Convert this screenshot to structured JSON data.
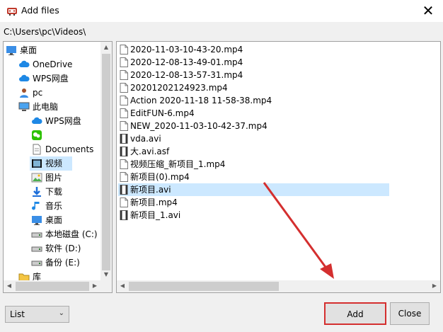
{
  "window": {
    "title": "Add files",
    "close_glyph": "✕"
  },
  "path": "C:\\Users\\pc\\Videos\\",
  "tree": [
    {
      "label": "桌面",
      "icon": "desktop-icon"
    },
    {
      "label": "OneDrive",
      "icon": "cloud-icon"
    },
    {
      "label": "WPS网盘",
      "icon": "cloud-icon"
    },
    {
      "label": "pc",
      "icon": "user-icon"
    },
    {
      "label": "此电脑",
      "icon": "computer-icon"
    },
    {
      "label": "WPS网盘",
      "icon": "cloud-icon"
    },
    {
      "label": "",
      "icon": "wechat-icon"
    },
    {
      "label": "Documents",
      "icon": "document-icon"
    },
    {
      "label": "视频",
      "icon": "video-folder-icon",
      "selected": true
    },
    {
      "label": "图片",
      "icon": "pictures-folder-icon"
    },
    {
      "label": "下载",
      "icon": "download-icon"
    },
    {
      "label": "音乐",
      "icon": "music-icon"
    },
    {
      "label": "桌面",
      "icon": "desktop-icon"
    },
    {
      "label": "本地磁盘 (C:)",
      "icon": "drive-icon"
    },
    {
      "label": "软件 (D:)",
      "icon": "drive-icon"
    },
    {
      "label": "备份 (E:)",
      "icon": "drive-icon"
    },
    {
      "label": "库",
      "icon": "library-icon"
    }
  ],
  "files": [
    {
      "name": "2020-11-03-10-43-20.mp4",
      "icon": "file-icon"
    },
    {
      "name": "2020-12-08-13-49-01.mp4",
      "icon": "file-icon"
    },
    {
      "name": "2020-12-08-13-57-31.mp4",
      "icon": "file-icon"
    },
    {
      "name": "20201202124923.mp4",
      "icon": "file-icon"
    },
    {
      "name": "Action 2020-11-18 11-58-38.mp4",
      "icon": "file-icon"
    },
    {
      "name": "EditFUN-6.mp4",
      "icon": "file-icon"
    },
    {
      "name": "NEW_2020-11-03-10-42-37.mp4",
      "icon": "file-icon"
    },
    {
      "name": "vda.avi",
      "icon": "video-file-icon"
    },
    {
      "name": "大.avi.asf",
      "icon": "video-file-icon"
    },
    {
      "name": "视频压缩_新项目_1.mp4",
      "icon": "file-icon"
    },
    {
      "name": "新项目(0).mp4",
      "icon": "file-icon"
    },
    {
      "name": "新项目.avi",
      "icon": "video-file-icon",
      "selected": true
    },
    {
      "name": "新项目.mp4",
      "icon": "file-icon"
    },
    {
      "name": "新项目_1.avi",
      "icon": "video-file-icon"
    }
  ],
  "view_mode": "List",
  "buttons": {
    "add": "Add",
    "close": "Close"
  },
  "colors": {
    "selection": "#cce8ff",
    "annotation_red": "#d42f2f"
  }
}
